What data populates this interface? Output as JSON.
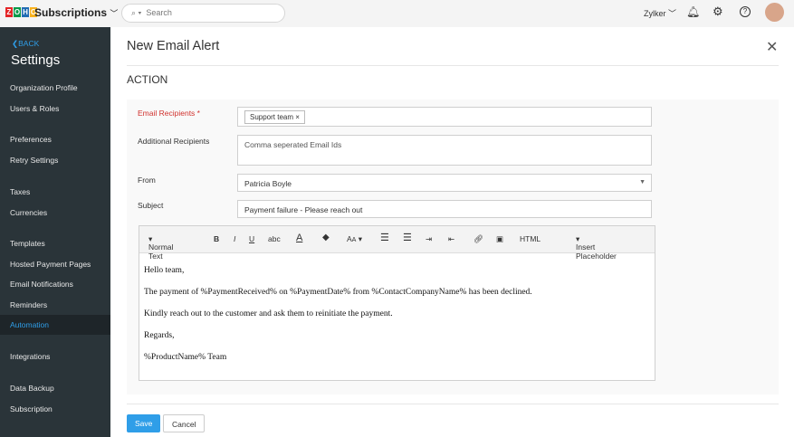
{
  "header": {
    "app_name": "Subscriptions",
    "logo": "ZOHO",
    "search_placeholder": "Search",
    "org": "Zylker"
  },
  "sidebar": {
    "back": "BACK",
    "title": "Settings",
    "items": [
      "Organization Profile",
      "Users & Roles",
      "Preferences",
      "Retry Settings",
      "Taxes",
      "Currencies",
      "Templates",
      "Hosted Payment Pages",
      "Email Notifications",
      "Reminders",
      "Automation",
      "Integrations",
      "Data Backup",
      "Subscription"
    ],
    "active": "Automation"
  },
  "modal": {
    "title": "New Email Alert",
    "section": "ACTION",
    "labels": {
      "recipients": "Email Recipients *",
      "additional": "Additional Recipients",
      "from": "From",
      "subject": "Subject"
    },
    "recipient_chip": "Support team",
    "additional_placeholder": "Comma seperated Email Ids",
    "from": "Patricia Boyle",
    "subject": "Payment failure - Please reach out",
    "toolbar": {
      "format": "Normal Text",
      "bold": "B",
      "italic": "I",
      "underline": "U",
      "strike": "abc",
      "font": "A̧",
      "html": "HTML",
      "placeholder": "Insert Placeholder"
    },
    "body": [
      "Hello team,",
      "The payment of %PaymentReceived% on %PaymentDate% from %ContactCompanyName% has been declined.",
      "Kindly reach out to the customer and ask them to reinitiate the payment.",
      "Regards,",
      "%ProductName% Team"
    ],
    "save": "Save",
    "cancel": "Cancel"
  },
  "colors": {
    "accent": "#2f9ee8",
    "sidebar": "#2a3439",
    "required": "#d0312d"
  }
}
